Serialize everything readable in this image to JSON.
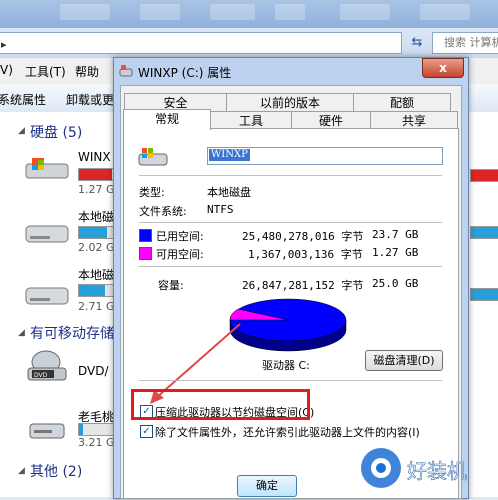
{
  "explorer": {
    "search_placeholder": "搜索 计算机",
    "menu": {
      "view": "V)",
      "tools": "工具(T)",
      "help": "帮助"
    },
    "commands": {
      "system_properties": "系统属性",
      "uninstall": "卸载或更"
    },
    "groups": {
      "hdd": "硬盘 (5)",
      "removable": "有可移动存储",
      "other": "其他 (2)"
    },
    "drives": [
      {
        "name": "WINX",
        "size": "1.27 G",
        "fill": 0.95
      },
      {
        "name": "本地磁",
        "size": "2.02 G",
        "fill": 0.8
      },
      {
        "name": "本地磁",
        "size": "2.71 G",
        "fill": 0.75
      }
    ],
    "removable_items": [
      {
        "name": "DVD/",
        "icon_label": "DVD"
      },
      {
        "name": "老毛桃",
        "size": "3.21 G"
      }
    ]
  },
  "dialog": {
    "title": "WINXP (C:) 属性",
    "close_label": "x",
    "tabs_row1": [
      "安全",
      "以前的版本",
      "配额"
    ],
    "tabs_row2": [
      "常规",
      "工具",
      "硬件",
      "共享"
    ],
    "selected_tab": "常规",
    "drive_name_value": "WINXP",
    "type_label": "类型:",
    "type_value": "本地磁盘",
    "fs_label": "文件系统:",
    "fs_value": "NTFS",
    "used_label": "已用空间:",
    "used_bytes": "25,480,278,016 字节",
    "used_gb": "23.7 GB",
    "free_label": "可用空间:",
    "free_bytes": "1,367,003,136 字节",
    "free_gb": "1.27 GB",
    "capacity_label": "容量:",
    "capacity_bytes": "26,847,281,152 字节",
    "capacity_gb": "25.0 GB",
    "drive_label": "驱动器 C:",
    "cleanup_button": "磁盘清理(D)",
    "compress_label": "压缩此驱动器以节约磁盘空间(C)",
    "index_label": "除了文件属性外，还允许索引此驱动器上文件的内容(I)",
    "compress_checked": true,
    "index_checked": true,
    "ok_button": "确定",
    "colors": {
      "used": "#0000ff",
      "free": "#ff00ff"
    }
  },
  "watermark": {
    "text": "好装机"
  }
}
